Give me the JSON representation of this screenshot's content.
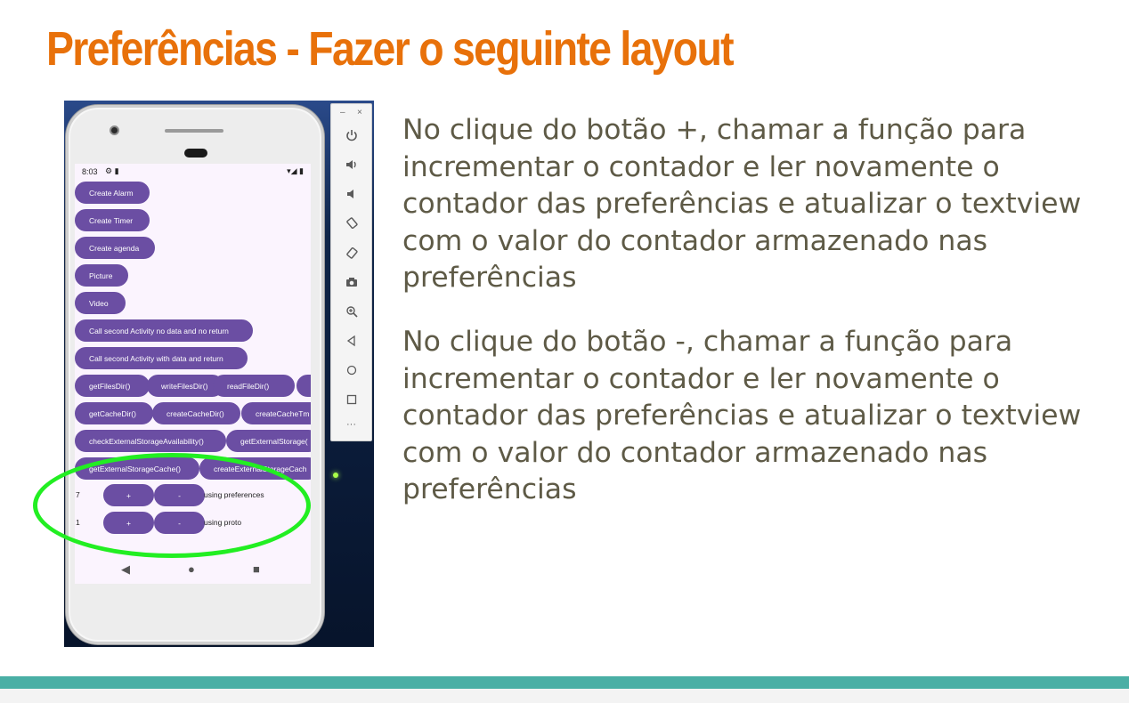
{
  "slide": {
    "title": "Preferências - Fazer o seguinte layout",
    "paragraph_plus": "No clique do botão +, chamar a função para incrementar o contador e ler novamente o contador das preferências e atualizar o textview com o valor do contador armazenado nas preferências",
    "paragraph_minus": "No clique do botão -, chamar a função para incrementar o contador e ler novamente o contador das preferências e atualizar o textview com o valor do contador armazenado nas preferências"
  },
  "phone": {
    "status_time": "8:03",
    "status_left_icons": "⚙ ▮",
    "status_right_icons": "▾◢ ▮",
    "buttons": {
      "create_alarm": "Create Alarm",
      "create_timer": "Create Timer",
      "create_agenda": "Create agenda",
      "picture": "Picture",
      "video": "Video",
      "second_no_data": "Call second Activity no data and no return",
      "second_with_data": "Call second Activity with data and return",
      "get_files_dir": "getFilesDir()",
      "write_files_dir": "writeFilesDir()",
      "read_file_dir": "readFileDir()",
      "get_cache_dir": "getCacheDir()",
      "create_cache_dir": "createCacheDir()",
      "create_cache_tm": "createCacheTm",
      "check_external": "checkExternalStorageAvailability()",
      "get_external": "getExternalStorage(",
      "get_external_cache": "getExternalStorageCache()",
      "create_external_cache": "createExternalStorageCach"
    },
    "pref_row": {
      "count": "7",
      "plus": "+",
      "minus": "-",
      "label": "using preferences"
    },
    "proto_row": {
      "count": "1",
      "plus": "+",
      "minus": "-",
      "label": "using proto"
    },
    "nav": {
      "back": "◀",
      "home": "●",
      "recents": "■"
    }
  },
  "emulator_toolbar": {
    "minimize": "–",
    "close": "×",
    "icons": [
      "power-icon",
      "volume-up-icon",
      "volume-down-icon",
      "rotate-left-icon",
      "rotate-right-icon",
      "camera-icon",
      "zoom-icon",
      "back-icon",
      "home-icon",
      "overview-icon",
      "more-icon"
    ],
    "more": "···"
  },
  "colors": {
    "title": "#e8710a",
    "button": "#6b4ea3",
    "highlight": "#22ee22",
    "footer_bar": "#4aafa5",
    "text": "#5e5a46"
  }
}
